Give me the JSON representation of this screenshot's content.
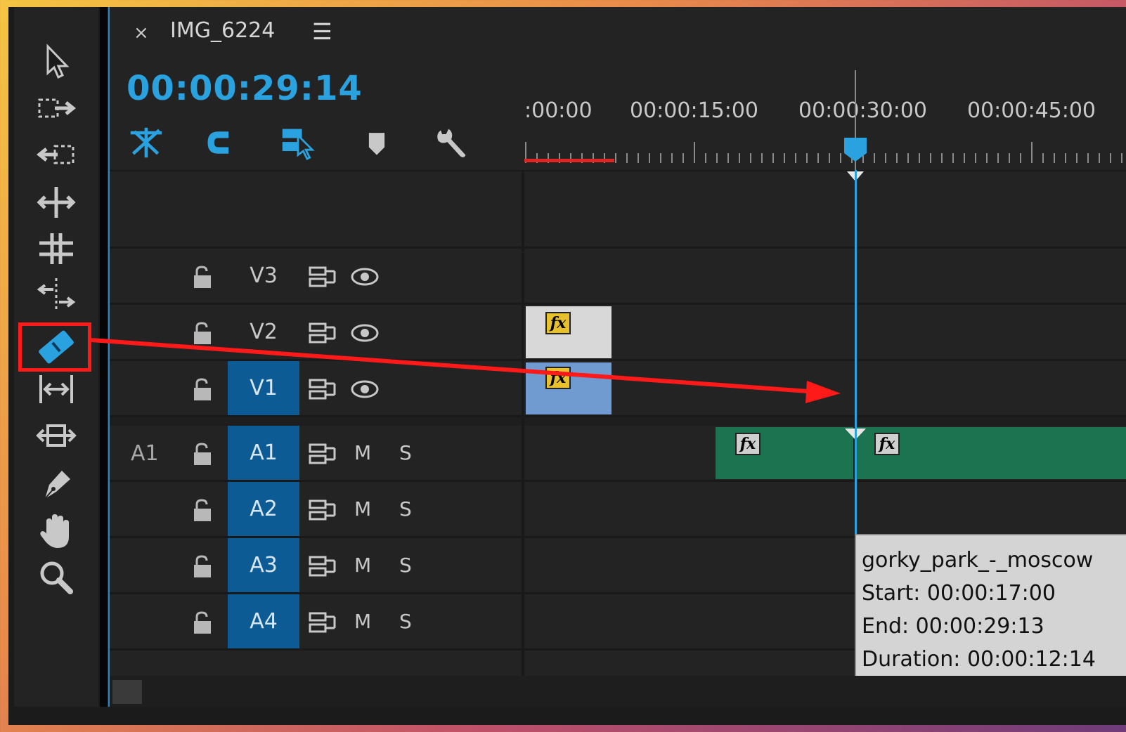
{
  "panel": {
    "close_glyph": "×",
    "sequence_name": "IMG_6224",
    "menu_glyph": "☰",
    "timecode": "00:00:29:14"
  },
  "ruler": {
    "labels": [
      ":00:00",
      "00:00:15:00",
      "00:00:30:00",
      "00:00:45:00"
    ]
  },
  "tracks": {
    "video": [
      {
        "name": "V3",
        "targeted": false
      },
      {
        "name": "V2",
        "targeted": false
      },
      {
        "name": "V1",
        "targeted": true
      }
    ],
    "audio": [
      {
        "source": "A1",
        "name": "A1",
        "mute": "M",
        "solo": "S"
      },
      {
        "source": "",
        "name": "A2",
        "mute": "M",
        "solo": "S"
      },
      {
        "source": "",
        "name": "A3",
        "mute": "M",
        "solo": "S"
      },
      {
        "source": "",
        "name": "A4",
        "mute": "M",
        "solo": "S"
      }
    ]
  },
  "clips": {
    "fx_label": "fx"
  },
  "tooltip": {
    "name": "gorky_park_-_moscow",
    "start": "Start: 00:00:17:00",
    "end": "End: 00:00:29:13",
    "duration": "Duration: 00:00:12:14"
  },
  "tools": [
    "selection-tool",
    "track-select-forward-tool",
    "track-select-backward-tool",
    "ripple-edit-tool",
    "rolling-edit-tool",
    "rate-stretch-tool",
    "razor-tool",
    "slip-tool",
    "slide-tool",
    "pen-tool",
    "hand-tool",
    "zoom-tool"
  ],
  "colors": {
    "accent": "#2aa2e0",
    "target_track": "#0c5b95",
    "audio_clip": "#1b7350",
    "video_clip_selected": "#6f9bd1",
    "annotation": "#ff1a1a"
  }
}
